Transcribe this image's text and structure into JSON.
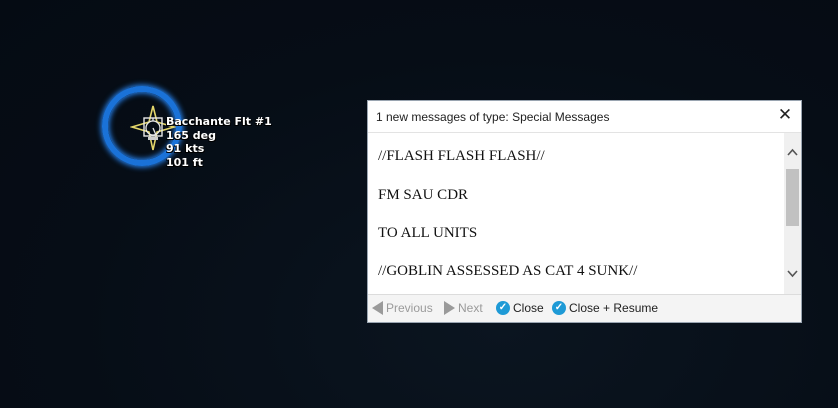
{
  "map": {
    "unit": {
      "name": "Bacchante Flt #1",
      "heading": "165 deg",
      "speed": "91 kts",
      "altitude": "101 ft"
    }
  },
  "dialog": {
    "title": "1 new messages of type: Special Messages",
    "close_glyph": "✕",
    "message_lines": [
      "//FLASH FLASH FLASH//",
      "FM SAU CDR",
      "TO ALL UNITS",
      "//GOBLIN ASSESSED AS CAT 4 SUNK//"
    ],
    "scroll_up_glyph": "⌃",
    "scroll_down_glyph": "⌄",
    "footer": {
      "previous_label": "Previous",
      "next_label": "Next",
      "close_label": "Close",
      "close_resume_label": "Close + Resume",
      "check_glyph": "✓"
    }
  },
  "colors": {
    "background": "#060d16",
    "unit_ring": "#1a72d8",
    "unit_symbol": "#e3d66b",
    "check_accent": "#1e9ad6",
    "disabled_text": "#9a9a9a"
  },
  "icons": {
    "unit_symbol": "helicopter-star-icon",
    "close": "close-icon",
    "previous": "arrow-left-icon",
    "next": "arrow-right-icon",
    "confirm": "check-circle-icon"
  }
}
